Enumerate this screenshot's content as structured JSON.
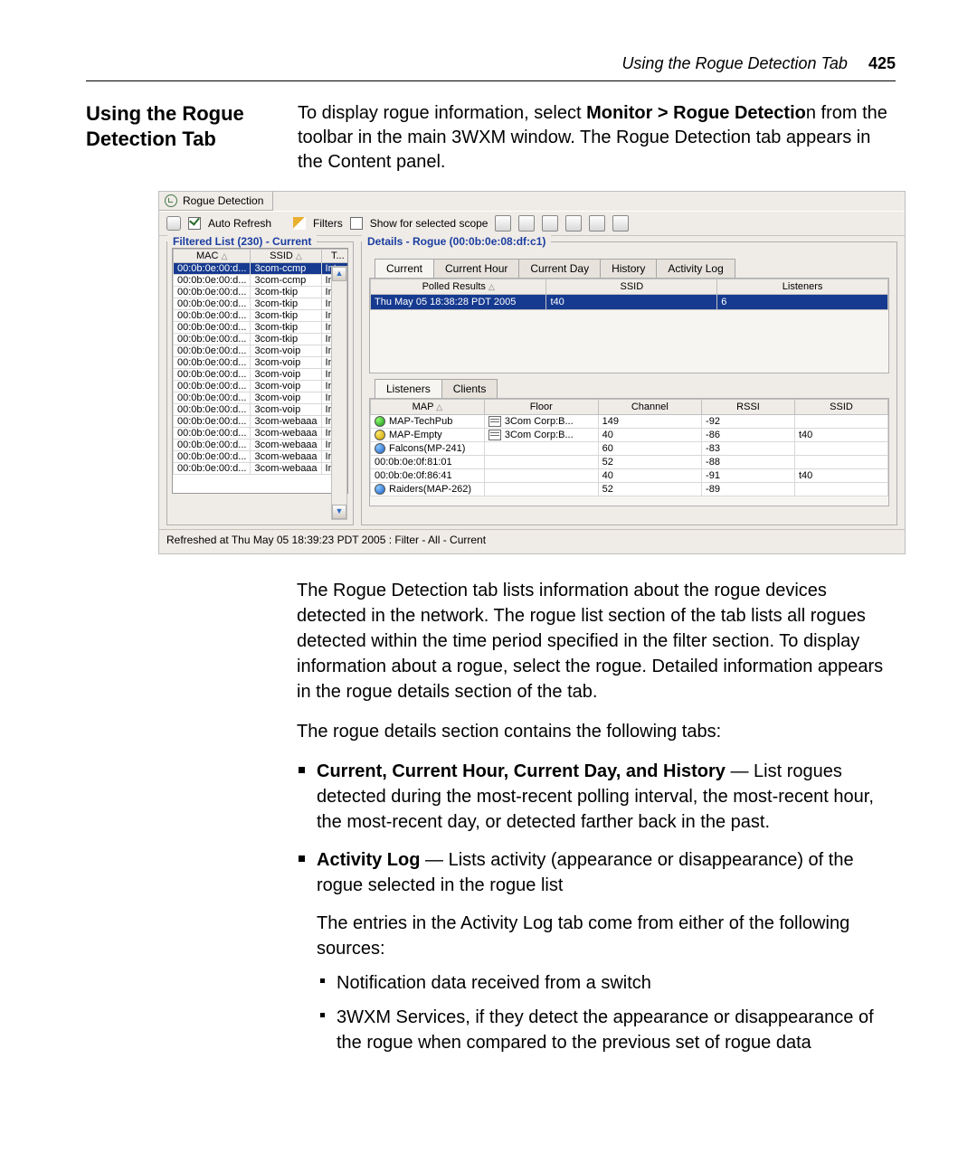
{
  "header": {
    "running": "Using the Rogue Detection Tab",
    "page": "425"
  },
  "section": {
    "title": "Using the Rogue Detection Tab"
  },
  "intro": {
    "pre": "To display rogue information, select ",
    "bold": "Monitor > Rogue Detectio",
    "post": "n from the toolbar in the main 3WXM window. The Rogue Detection tab appears in the Content panel."
  },
  "ss": {
    "tab": "Rogue Detection",
    "autorefresh": "Auto Refresh",
    "filters": "Filters",
    "scope": "Show for selected scope",
    "leftTitle": "Filtered List (230) - Current",
    "cols": {
      "mac": "MAC",
      "ssid": "SSID",
      "t": "T..."
    },
    "rows": [
      {
        "mac": "00:0b:0e:00:d...",
        "ssid": "3com-ccmp",
        "t": "Inte..."
      },
      {
        "mac": "00:0b:0e:00:d...",
        "ssid": "3com-ccmp",
        "t": "Inte..."
      },
      {
        "mac": "00:0b:0e:00:d...",
        "ssid": "3com-tkip",
        "t": "Inte..."
      },
      {
        "mac": "00:0b:0e:00:d...",
        "ssid": "3com-tkip",
        "t": "Inte..."
      },
      {
        "mac": "00:0b:0e:00:d...",
        "ssid": "3com-tkip",
        "t": "Inte..."
      },
      {
        "mac": "00:0b:0e:00:d...",
        "ssid": "3com-tkip",
        "t": "Inte..."
      },
      {
        "mac": "00:0b:0e:00:d...",
        "ssid": "3com-tkip",
        "t": "Inte..."
      },
      {
        "mac": "00:0b:0e:00:d...",
        "ssid": "3com-voip",
        "t": "Inte..."
      },
      {
        "mac": "00:0b:0e:00:d...",
        "ssid": "3com-voip",
        "t": "Inte..."
      },
      {
        "mac": "00:0b:0e:00:d...",
        "ssid": "3com-voip",
        "t": "Inte..."
      },
      {
        "mac": "00:0b:0e:00:d...",
        "ssid": "3com-voip",
        "t": "Inte..."
      },
      {
        "mac": "00:0b:0e:00:d...",
        "ssid": "3com-voip",
        "t": "Inte..."
      },
      {
        "mac": "00:0b:0e:00:d...",
        "ssid": "3com-voip",
        "t": "Inte..."
      },
      {
        "mac": "00:0b:0e:00:d...",
        "ssid": "3com-webaaa",
        "t": "Inte..."
      },
      {
        "mac": "00:0b:0e:00:d...",
        "ssid": "3com-webaaa",
        "t": "Inte..."
      },
      {
        "mac": "00:0b:0e:00:d...",
        "ssid": "3com-webaaa",
        "t": "Inte..."
      },
      {
        "mac": "00:0b:0e:00:d...",
        "ssid": "3com-webaaa",
        "t": "Inte..."
      },
      {
        "mac": "00:0b:0e:00:d...",
        "ssid": "3com-webaaa",
        "t": "Inte..."
      }
    ],
    "detailsTitle": "Details - Rogue (00:0b:0e:08:df:c1)",
    "dtabs": {
      "current": "Current",
      "hour": "Current Hour",
      "day": "Current Day",
      "hist": "History",
      "log": "Activity Log"
    },
    "polled": {
      "h1": "Polled Results",
      "h2": "SSID",
      "h3": "Listeners",
      "r1": "Thu May 05 18:38:28 PDT 2005",
      "r2": "t40",
      "r3": "6"
    },
    "ltabs": {
      "listeners": "Listeners",
      "clients": "Clients"
    },
    "mcols": {
      "map": "MAP",
      "floor": "Floor",
      "chan": "Channel",
      "rssi": "RSSI",
      "ssid": "SSID"
    },
    "mrows": [
      {
        "icon": "g",
        "map": "MAP-TechPub",
        "floor": "3Com Corp:B...",
        "fl": 1,
        "chan": "149",
        "rssi": "-92",
        "ssid": ""
      },
      {
        "icon": "y",
        "map": "MAP-Empty",
        "floor": "3Com Corp:B...",
        "fl": 1,
        "chan": "40",
        "rssi": "-86",
        "ssid": "t40"
      },
      {
        "icon": "b",
        "map": "Falcons(MP-241)",
        "floor": "",
        "fl": 0,
        "chan": "60",
        "rssi": "-83",
        "ssid": ""
      },
      {
        "icon": "",
        "map": "00:0b:0e:0f:81:01",
        "floor": "",
        "fl": 0,
        "chan": "52",
        "rssi": "-88",
        "ssid": ""
      },
      {
        "icon": "",
        "map": "00:0b:0e:0f:86:41",
        "floor": "",
        "fl": 0,
        "chan": "40",
        "rssi": "-91",
        "ssid": "t40"
      },
      {
        "icon": "b",
        "map": "Raiders(MAP-262)",
        "floor": "",
        "fl": 0,
        "chan": "52",
        "rssi": "-89",
        "ssid": ""
      }
    ],
    "status": "Refreshed at Thu May 05 18:39:23 PDT 2005 : Filter - All - Current"
  },
  "para1": "The Rogue Detection tab lists information about the rogue devices detected in the network. The rogue list section of the tab lists all rogues detected within the time period specified in the filter section. To display information about a rogue, select the rogue. Detailed information appears in the rogue details section of the tab.",
  "para2": "The rogue details section contains the following tabs:",
  "b1b": "Current, Current Hour, Current Day, and History",
  "b1t": " — List rogues detected during the most-recent polling interval, the most-recent hour, the most-recent day, or detected farther back in the past.",
  "b2b": "Activity Log",
  "b2t": " — Lists activity (appearance or disappearance) of the rogue selected in the rogue list",
  "b2p": "The entries in the Activity Log tab come from either of the following sources:",
  "s1": "Notification data received from a switch",
  "s2": "3WXM Services, if they detect the appearance or disappearance of the rogue when compared to the previous set of rogue data"
}
